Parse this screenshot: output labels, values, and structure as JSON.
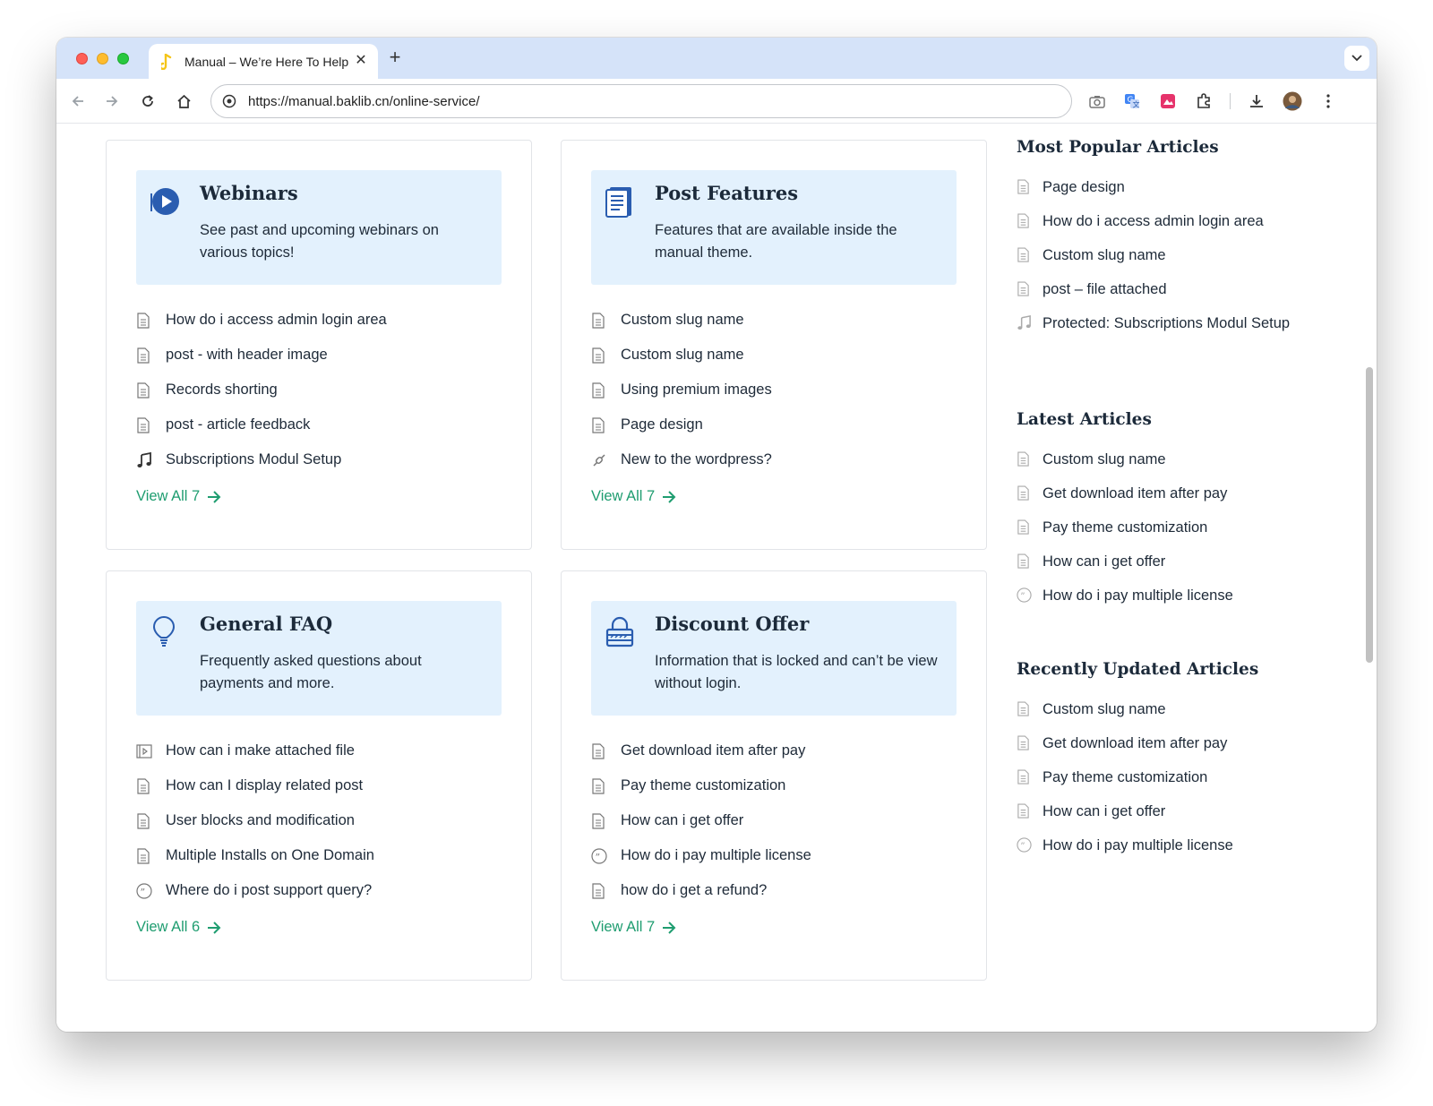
{
  "browser": {
    "tab_title": "Manual – We’re Here To Help",
    "url_scheme": "https://",
    "url_host": "manual.baklib.cn",
    "url_path": "/online-service/"
  },
  "cards": [
    {
      "title": "Webinars",
      "description": "See past and upcoming webinars on various topics!",
      "icon": "play-circle-icon",
      "items": [
        {
          "icon": "document-icon",
          "label": "How do i access admin login area"
        },
        {
          "icon": "document-icon",
          "label": "post - with header image"
        },
        {
          "icon": "document-icon",
          "label": "Records shorting"
        },
        {
          "icon": "document-icon",
          "label": "post - article feedback"
        },
        {
          "icon": "music-note-icon",
          "label": "Subscriptions Modul Setup"
        }
      ],
      "view_all": "View All 7"
    },
    {
      "title": "Post Features",
      "description": "Features that are available inside the manual theme.",
      "icon": "document-stack-icon",
      "items": [
        {
          "icon": "document-icon",
          "label": "Custom slug name"
        },
        {
          "icon": "document-icon",
          "label": "Custom slug name"
        },
        {
          "icon": "document-icon",
          "label": "Using premium images"
        },
        {
          "icon": "document-icon",
          "label": "Page design"
        },
        {
          "icon": "link-icon",
          "label": "New to the wordpress?"
        }
      ],
      "view_all": "View All 7"
    },
    {
      "title": "General FAQ",
      "description": "Frequently asked questions about payments and more.",
      "icon": "lightbulb-icon",
      "items": [
        {
          "icon": "video-file-icon",
          "label": "How can i make attached file"
        },
        {
          "icon": "document-icon",
          "label": "How can I display related post"
        },
        {
          "icon": "document-icon",
          "label": "User blocks and modification"
        },
        {
          "icon": "document-icon",
          "label": "Multiple Installs on One Domain"
        },
        {
          "icon": "quote-icon",
          "label": "Where do i post support query?"
        }
      ],
      "view_all": "View All 6"
    },
    {
      "title": "Discount Offer",
      "description": "Information that is locked and can’t be view without login.",
      "icon": "lock-icon",
      "items": [
        {
          "icon": "document-icon",
          "label": "Get download item after pay"
        },
        {
          "icon": "document-icon",
          "label": "Pay theme customization"
        },
        {
          "icon": "document-icon",
          "label": "How can i get offer"
        },
        {
          "icon": "quote-icon",
          "label": "How do i pay multiple license"
        },
        {
          "icon": "document-icon",
          "label": "how do i get a refund?"
        }
      ],
      "view_all": "View All 7"
    }
  ],
  "sidebar": {
    "popular": {
      "heading": "Most Popular Articles",
      "items": [
        {
          "icon": "document-icon",
          "label": "Page design"
        },
        {
          "icon": "document-icon",
          "label": "How do i access admin login area"
        },
        {
          "icon": "document-icon",
          "label": "Custom slug name"
        },
        {
          "icon": "document-icon",
          "label": "post – file attached"
        },
        {
          "icon": "music-note-icon",
          "label": "Protected: Subscriptions Modul Setup"
        }
      ]
    },
    "latest": {
      "heading": "Latest Articles",
      "items": [
        {
          "icon": "document-icon",
          "label": "Custom slug name"
        },
        {
          "icon": "document-icon",
          "label": "Get download item after pay"
        },
        {
          "icon": "document-icon",
          "label": "Pay theme customization"
        },
        {
          "icon": "document-icon",
          "label": "How can i get offer"
        },
        {
          "icon": "quote-icon",
          "label": "How do i pay multiple license"
        }
      ]
    },
    "updated": {
      "heading": "Recently Updated Articles",
      "items": [
        {
          "icon": "document-icon",
          "label": "Custom slug name"
        },
        {
          "icon": "document-icon",
          "label": "Get download item after pay"
        },
        {
          "icon": "document-icon",
          "label": "Pay theme customization"
        },
        {
          "icon": "document-icon",
          "label": "How can i get offer"
        },
        {
          "icon": "quote-icon",
          "label": "How do i pay multiple license"
        }
      ]
    }
  },
  "colors": {
    "accent_green": "#1f9d70",
    "card_head_bg": "#e3f1fd",
    "icon_blue": "#2a5db0"
  }
}
